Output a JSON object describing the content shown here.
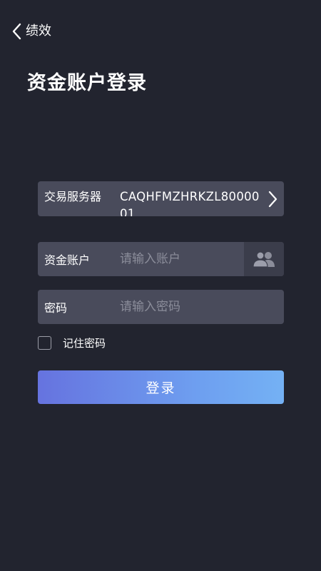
{
  "header": {
    "back_label": "绩效",
    "back_icon": "chevron-left-icon"
  },
  "page": {
    "title": "资金账户登录"
  },
  "form": {
    "server": {
      "label": "交易服务器",
      "value": "CAQHFMZHRKZL8000001",
      "icon": "chevron-right-icon"
    },
    "account": {
      "label": "资金账户",
      "value": "",
      "placeholder": "请输入账户",
      "icon": "users-icon"
    },
    "password": {
      "label": "密码",
      "value": "",
      "placeholder": "请输入密码"
    },
    "remember": {
      "label": "记住密码",
      "checked": false
    },
    "submit_label": "登录"
  },
  "colors": {
    "background": "#22242f",
    "field": "#494b5b",
    "field_icon_bg": "#3b3d4b",
    "button_gradient_start": "#6673df",
    "button_gradient_end": "#74b1f4"
  }
}
